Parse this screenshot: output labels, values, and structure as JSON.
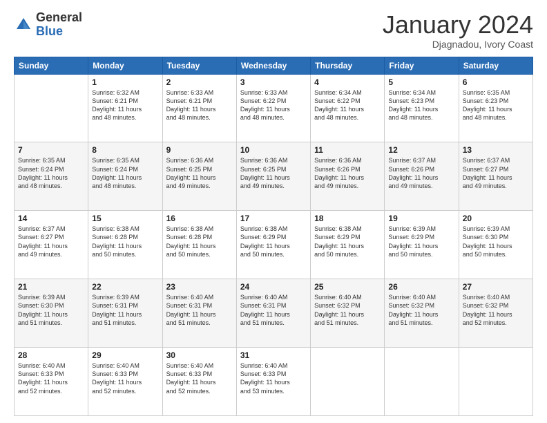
{
  "header": {
    "logo_general": "General",
    "logo_blue": "Blue",
    "title": "January 2024",
    "subtitle": "Djagnadou, Ivory Coast"
  },
  "days_of_week": [
    "Sunday",
    "Monday",
    "Tuesday",
    "Wednesday",
    "Thursday",
    "Friday",
    "Saturday"
  ],
  "weeks": [
    [
      {
        "num": "",
        "info": ""
      },
      {
        "num": "1",
        "info": "Sunrise: 6:32 AM\nSunset: 6:21 PM\nDaylight: 11 hours\nand 48 minutes."
      },
      {
        "num": "2",
        "info": "Sunrise: 6:33 AM\nSunset: 6:21 PM\nDaylight: 11 hours\nand 48 minutes."
      },
      {
        "num": "3",
        "info": "Sunrise: 6:33 AM\nSunset: 6:22 PM\nDaylight: 11 hours\nand 48 minutes."
      },
      {
        "num": "4",
        "info": "Sunrise: 6:34 AM\nSunset: 6:22 PM\nDaylight: 11 hours\nand 48 minutes."
      },
      {
        "num": "5",
        "info": "Sunrise: 6:34 AM\nSunset: 6:23 PM\nDaylight: 11 hours\nand 48 minutes."
      },
      {
        "num": "6",
        "info": "Sunrise: 6:35 AM\nSunset: 6:23 PM\nDaylight: 11 hours\nand 48 minutes."
      }
    ],
    [
      {
        "num": "7",
        "info": "Sunrise: 6:35 AM\nSunset: 6:24 PM\nDaylight: 11 hours\nand 48 minutes."
      },
      {
        "num": "8",
        "info": "Sunrise: 6:35 AM\nSunset: 6:24 PM\nDaylight: 11 hours\nand 48 minutes."
      },
      {
        "num": "9",
        "info": "Sunrise: 6:36 AM\nSunset: 6:25 PM\nDaylight: 11 hours\nand 49 minutes."
      },
      {
        "num": "10",
        "info": "Sunrise: 6:36 AM\nSunset: 6:25 PM\nDaylight: 11 hours\nand 49 minutes."
      },
      {
        "num": "11",
        "info": "Sunrise: 6:36 AM\nSunset: 6:26 PM\nDaylight: 11 hours\nand 49 minutes."
      },
      {
        "num": "12",
        "info": "Sunrise: 6:37 AM\nSunset: 6:26 PM\nDaylight: 11 hours\nand 49 minutes."
      },
      {
        "num": "13",
        "info": "Sunrise: 6:37 AM\nSunset: 6:27 PM\nDaylight: 11 hours\nand 49 minutes."
      }
    ],
    [
      {
        "num": "14",
        "info": "Sunrise: 6:37 AM\nSunset: 6:27 PM\nDaylight: 11 hours\nand 49 minutes."
      },
      {
        "num": "15",
        "info": "Sunrise: 6:38 AM\nSunset: 6:28 PM\nDaylight: 11 hours\nand 50 minutes."
      },
      {
        "num": "16",
        "info": "Sunrise: 6:38 AM\nSunset: 6:28 PM\nDaylight: 11 hours\nand 50 minutes."
      },
      {
        "num": "17",
        "info": "Sunrise: 6:38 AM\nSunset: 6:29 PM\nDaylight: 11 hours\nand 50 minutes."
      },
      {
        "num": "18",
        "info": "Sunrise: 6:38 AM\nSunset: 6:29 PM\nDaylight: 11 hours\nand 50 minutes."
      },
      {
        "num": "19",
        "info": "Sunrise: 6:39 AM\nSunset: 6:29 PM\nDaylight: 11 hours\nand 50 minutes."
      },
      {
        "num": "20",
        "info": "Sunrise: 6:39 AM\nSunset: 6:30 PM\nDaylight: 11 hours\nand 50 minutes."
      }
    ],
    [
      {
        "num": "21",
        "info": "Sunrise: 6:39 AM\nSunset: 6:30 PM\nDaylight: 11 hours\nand 51 minutes."
      },
      {
        "num": "22",
        "info": "Sunrise: 6:39 AM\nSunset: 6:31 PM\nDaylight: 11 hours\nand 51 minutes."
      },
      {
        "num": "23",
        "info": "Sunrise: 6:40 AM\nSunset: 6:31 PM\nDaylight: 11 hours\nand 51 minutes."
      },
      {
        "num": "24",
        "info": "Sunrise: 6:40 AM\nSunset: 6:31 PM\nDaylight: 11 hours\nand 51 minutes."
      },
      {
        "num": "25",
        "info": "Sunrise: 6:40 AM\nSunset: 6:32 PM\nDaylight: 11 hours\nand 51 minutes."
      },
      {
        "num": "26",
        "info": "Sunrise: 6:40 AM\nSunset: 6:32 PM\nDaylight: 11 hours\nand 51 minutes."
      },
      {
        "num": "27",
        "info": "Sunrise: 6:40 AM\nSunset: 6:32 PM\nDaylight: 11 hours\nand 52 minutes."
      }
    ],
    [
      {
        "num": "28",
        "info": "Sunrise: 6:40 AM\nSunset: 6:33 PM\nDaylight: 11 hours\nand 52 minutes."
      },
      {
        "num": "29",
        "info": "Sunrise: 6:40 AM\nSunset: 6:33 PM\nDaylight: 11 hours\nand 52 minutes."
      },
      {
        "num": "30",
        "info": "Sunrise: 6:40 AM\nSunset: 6:33 PM\nDaylight: 11 hours\nand 52 minutes."
      },
      {
        "num": "31",
        "info": "Sunrise: 6:40 AM\nSunset: 6:33 PM\nDaylight: 11 hours\nand 53 minutes."
      },
      {
        "num": "",
        "info": ""
      },
      {
        "num": "",
        "info": ""
      },
      {
        "num": "",
        "info": ""
      }
    ]
  ]
}
